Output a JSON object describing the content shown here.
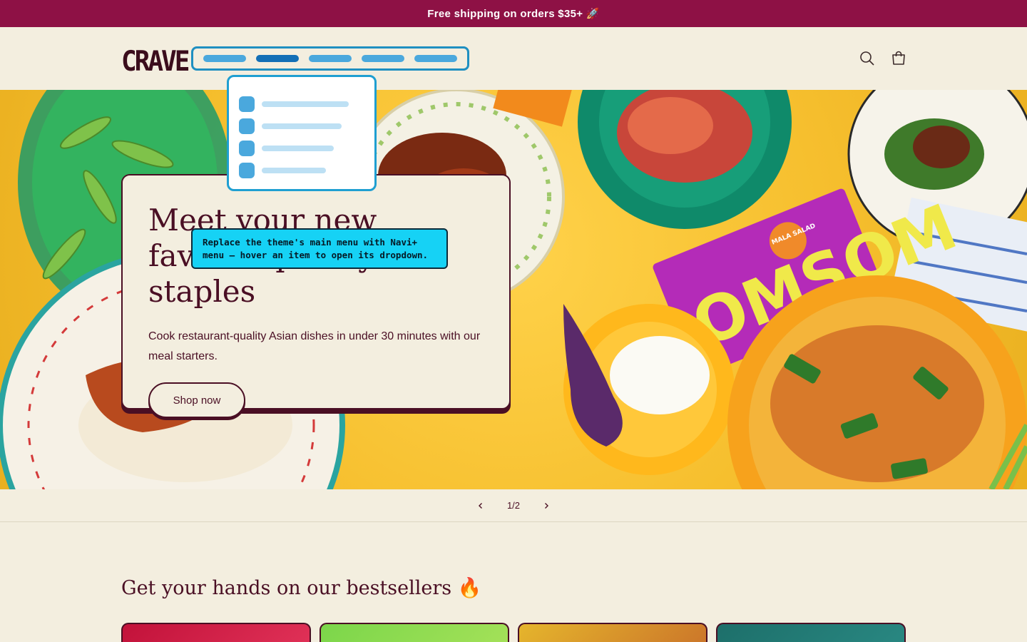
{
  "announcement": {
    "text": "Free shipping on orders $35+ 🚀"
  },
  "header": {
    "logo": "CRAVE",
    "icons": [
      "search-icon",
      "cart-icon"
    ],
    "navi_preview": {
      "pill_count": 5,
      "active_index": 1
    }
  },
  "hero": {
    "headline": "Meet your new favorite pantry staples",
    "body": "Cook restaurant-quality Asian dishes in under 30 minutes with our meal starters.",
    "cta": "Shop now",
    "product_packet": {
      "brand": "OMSOM",
      "flavor": "MALA SALAD"
    }
  },
  "tooltip": {
    "text": "Replace the theme's main menu with Navi+ menu — hover an item to open its dropdown."
  },
  "slideshow": {
    "counter": "1/2"
  },
  "bestsellers": {
    "title": "Get your hands on our bestsellers 🔥",
    "cards": [
      {
        "color": "#c2123a"
      },
      {
        "color": "#7bd64a"
      },
      {
        "color": "#e5b52c"
      },
      {
        "color": "#1d6f6a"
      }
    ]
  },
  "colors": {
    "brand": "#8e1145",
    "text": "#4a0f24",
    "background": "#f3eedf",
    "navi_accent": "#1f8fc1",
    "tooltip": "#16d2f5"
  }
}
